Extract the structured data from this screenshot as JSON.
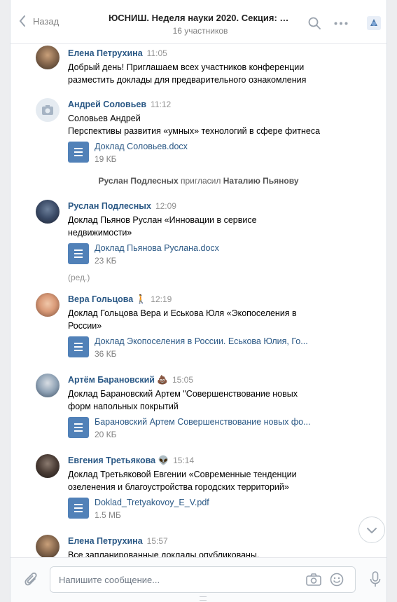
{
  "header": {
    "back_label": "Назад",
    "title": "ЮСНИШ. Неделя науки 2020. Секция: «...",
    "subtitle": "16 участников"
  },
  "messages": [
    {
      "name": "Елена Петрухина",
      "time": "11:05",
      "lines": [
        "Добрый день! Приглашаем всех участников конференции",
        "разместить доклады для предварительного ознакомления"
      ]
    },
    {
      "name": "Андрей Соловьев",
      "time": "11:12",
      "lines": [
        "Соловьев Андрей",
        "Перспективы развития «умных» технологий в сфере фитнеса"
      ],
      "doc": {
        "name": "Доклад Соловьев.docx",
        "size": "19 КБ"
      }
    },
    {
      "name": "Руслан Подлесных",
      "time": "12:09",
      "lines": [
        "Доклад Пьянов Руслан «Инновации в сервисе",
        "недвижимости»"
      ],
      "doc": {
        "name": "Доклад Пьянова Руслана.docx",
        "size": "23 КБ"
      },
      "edited": "(ред.)"
    },
    {
      "name": "Вера Гольцова 🚶",
      "time": "12:19",
      "lines": [
        "Доклад Гольцова Вера и Еськова Юля «Экопоселения в",
        "России»"
      ],
      "doc": {
        "name": "Доклад Экопоселения в России. Еськова Юлия, Го...",
        "size": "36 КБ"
      }
    },
    {
      "name": "Артём Барановский 💩",
      "time": "15:05",
      "lines": [
        "Доклад Барановский Артем \"Совершенствование новых",
        "форм напольных покрытий"
      ],
      "doc": {
        "name": "Барановский Артем Совершенствование новых фо...",
        "size": "20 КБ"
      }
    },
    {
      "name": "Евгения Третьякова 👽",
      "time": "15:14",
      "lines": [
        "Доклад Третьяковой Евгении «Современные тенденции",
        "озеленения и благоустройства городских территорий»"
      ],
      "doc": {
        "name": "Doklad_Tretyakovoy_E_V.pdf",
        "size": "1.5 МБ"
      }
    },
    {
      "name": "Елена Петрухина",
      "time": "15:57",
      "lines": [
        "Все запланированные доклады опубликованы."
      ]
    }
  ],
  "service": {
    "actor": "Руслан Подлесных",
    "action": "пригласил",
    "target": "Наталию Пьянову"
  },
  "composer": {
    "placeholder": "Напишите сообщение..."
  },
  "colors": {
    "link": "#2a5885",
    "doc_icon": "#5181b8",
    "background": "#edeef0"
  }
}
